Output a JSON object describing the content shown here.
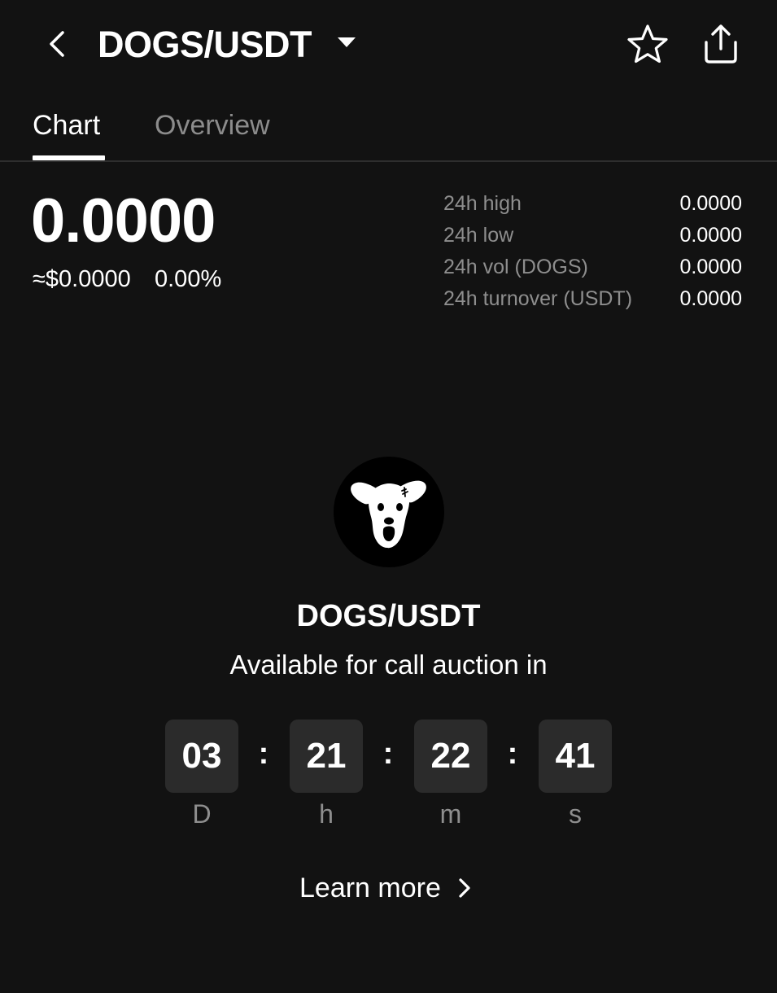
{
  "header": {
    "pair": "DOGS/USDT",
    "icons": {
      "back": "chevron-left-icon",
      "pair_dropdown": "caret-down-icon",
      "favorite": "star-outline-icon",
      "share": "share-upload-icon"
    }
  },
  "tabs": [
    {
      "label": "Chart",
      "active": true
    },
    {
      "label": "Overview",
      "active": false
    }
  ],
  "price": {
    "last": "0.0000",
    "fiat": "≈$0.0000",
    "change": "0.00%"
  },
  "stats": [
    {
      "label": "24h high",
      "value": "0.0000"
    },
    {
      "label": "24h low",
      "value": "0.0000"
    },
    {
      "label": "24h vol (DOGS)",
      "value": "0.0000"
    },
    {
      "label": "24h turnover (USDT)",
      "value": "0.0000"
    }
  ],
  "token": {
    "logo": "dogs-token-logo",
    "pair": "DOGS/USDT",
    "message": "Available for call auction in"
  },
  "countdown": {
    "days": "03",
    "hours": "21",
    "minutes": "22",
    "seconds": "41",
    "separator": ":",
    "units": {
      "days": "D",
      "hours": "h",
      "minutes": "m",
      "seconds": "s"
    }
  },
  "learn_more": {
    "label": "Learn more",
    "icon": "chevron-right-icon"
  },
  "colors": {
    "background": "#121212",
    "text_primary": "#ffffff",
    "text_secondary": "#8e8e8e",
    "countdown_box": "#2b2b2b",
    "divider": "#2e2e2e"
  }
}
